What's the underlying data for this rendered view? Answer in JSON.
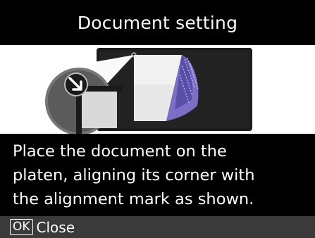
{
  "title": "Document setting",
  "message": {
    "lines": [
      "Place the document on the",
      "platen, aligning its corner with",
      "the alignment mark as shown."
    ]
  },
  "footer": {
    "ok_key": "OK",
    "close_label": "Close"
  },
  "colors": {
    "background": "#000000",
    "illustration_background": "#ffffff",
    "footer_background": "#3a3a3a",
    "platen": "#1c1c1c",
    "document_curl": "#6f63b8"
  },
  "icons": {
    "illustration": "document-on-platen-illustration",
    "magnifier": "alignment-mark-magnifier-icon",
    "arrow": "corner-arrow-icon"
  }
}
